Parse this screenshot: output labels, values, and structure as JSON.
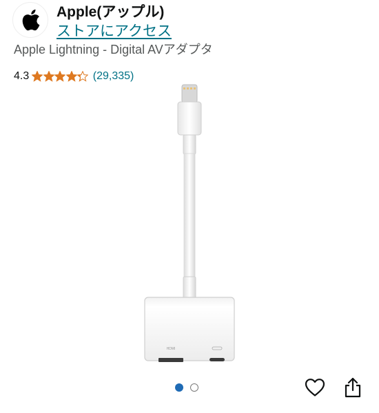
{
  "brand": {
    "name": "Apple(アップル)",
    "store_link": "ストアにアクセス",
    "logo_icon": "apple-logo-icon"
  },
  "product": {
    "title": "Apple Lightning - Digital AVアダプタ",
    "image_labels": {
      "port_left": "HDMI"
    }
  },
  "rating": {
    "value": "4.3",
    "stars": 4.3,
    "review_count": "(29,335)"
  },
  "carousel": {
    "total": 2,
    "active_index": 0
  },
  "actions": {
    "wishlist_icon": "heart-icon",
    "share_icon": "share-icon"
  },
  "colors": {
    "link": "#007185",
    "star": "#de7921",
    "dot_active": "#1f6bb5",
    "text_secondary": "#565959"
  }
}
